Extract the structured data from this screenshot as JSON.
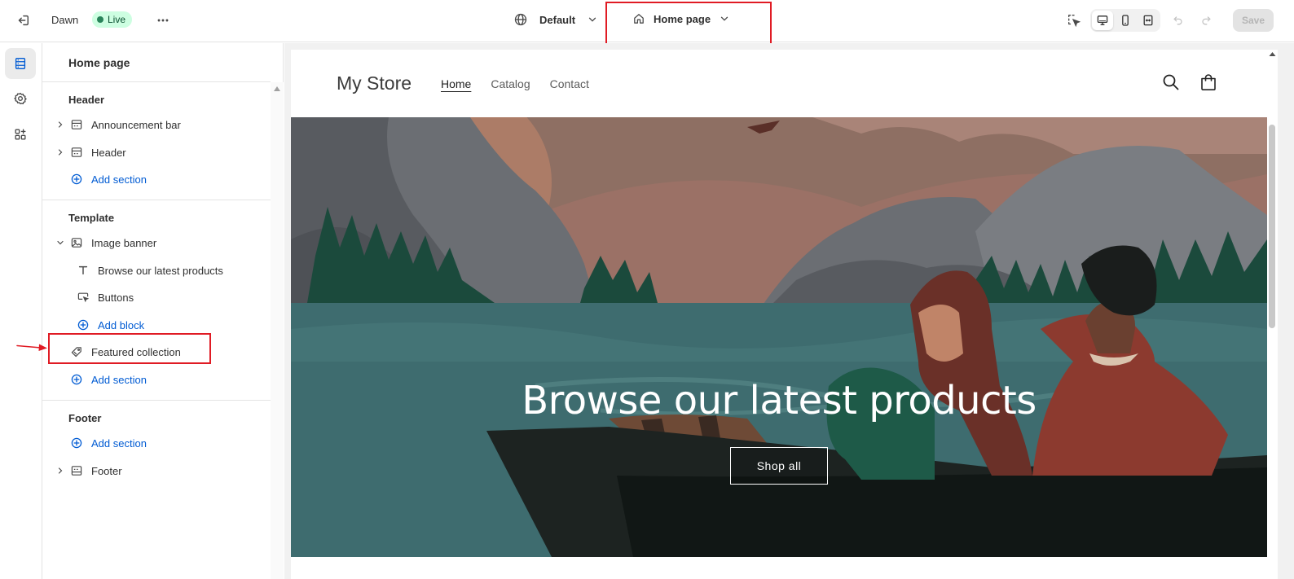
{
  "topbar": {
    "theme_name": "Dawn",
    "status": "Live",
    "locale_label": "Default",
    "page_selector": "Home page",
    "save_label": "Save"
  },
  "sidebar": {
    "title": "Home page",
    "header_group": {
      "heading": "Header",
      "items": [
        "Announcement bar",
        "Header"
      ],
      "add_label": "Add section"
    },
    "template_group": {
      "heading": "Template",
      "image_banner": "Image banner",
      "blocks": [
        "Browse our latest products",
        "Buttons"
      ],
      "add_block_label": "Add block",
      "featured_collection": "Featured collection",
      "add_label": "Add section"
    },
    "footer_group": {
      "heading": "Footer",
      "add_label": "Add section",
      "items": [
        "Footer"
      ]
    }
  },
  "preview": {
    "store_name": "My Store",
    "nav": [
      "Home",
      "Catalog",
      "Contact"
    ],
    "hero_title": "Browse our latest products",
    "hero_button": "Shop all"
  },
  "colors": {
    "accent": "#005bd3",
    "highlight": "#e01b24",
    "live_bg": "#cdfee1"
  }
}
